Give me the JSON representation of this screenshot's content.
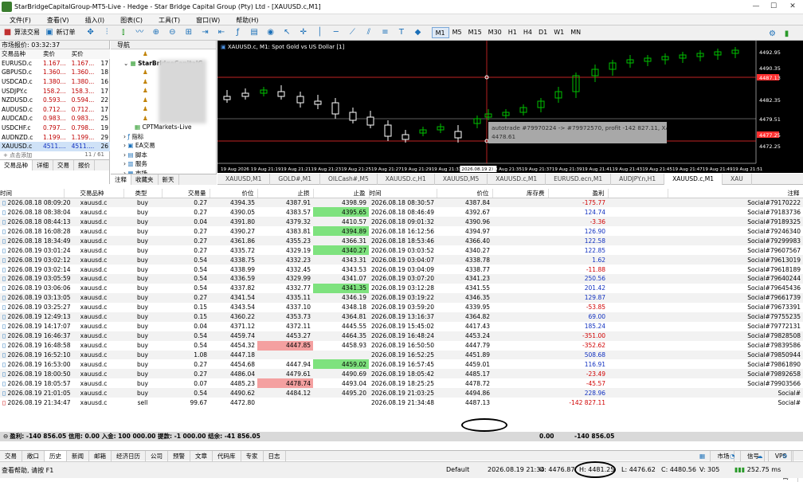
{
  "window": {
    "title": "StarBridgeCapitalGroup-MT5-Live - Hedge - Star Bridge Capital Group (Pty) Ltd - [XAUUSD.c,M1]",
    "controls": [
      "—",
      "☐",
      "✕"
    ]
  },
  "menu": [
    "文件(F)",
    "查看(V)",
    "插入(I)",
    "图表(C)",
    "工具(T)",
    "窗口(W)",
    "帮助(H)"
  ],
  "toolbar": {
    "algo_label": "算法交易",
    "new_order_label": "新订单",
    "timeframes": [
      "M1",
      "M5",
      "M15",
      "M30",
      "H1",
      "H4",
      "D1",
      "W1",
      "MN"
    ],
    "active_tf": "M1"
  },
  "market_watch": {
    "title": "市场报价: 03:32:37",
    "headers": [
      "交易品种",
      "卖价",
      "买价",
      ""
    ],
    "rows": [
      [
        "EURUSD.c",
        "1.167...",
        "1.167...",
        "17"
      ],
      [
        "GBPUSD.c",
        "1.360...",
        "1.360...",
        "18"
      ],
      [
        "USDCAD.c",
        "1.380...",
        "1.380...",
        "16"
      ],
      [
        "USDJPY.c",
        "158.2...",
        "158.3...",
        "17"
      ],
      [
        "NZDUSD.c",
        "0.593...",
        "0.594...",
        "22"
      ],
      [
        "AUDUSD.c",
        "0.712...",
        "0.712...",
        "17"
      ],
      [
        "AUDCAD.c",
        "0.983...",
        "0.983...",
        "25"
      ],
      [
        "USDCHF.c",
        "0.797...",
        "0.798...",
        "19"
      ],
      [
        "AUDNZD.c",
        "1.199...",
        "1.199...",
        "29"
      ],
      [
        "XAUUSD.c",
        "4511....",
        "4511....",
        "26"
      ]
    ],
    "footer_left": "+ 点击添加",
    "footer_right": "11 / 61",
    "tabs": [
      "交易品种",
      "详细",
      "交易",
      "报价"
    ]
  },
  "navigator": {
    "title": "导航",
    "broker": "StarBridgeCapitalG",
    "items": [
      "CPTMarkets-Live",
      "指标",
      "EA交易",
      "脚本",
      "服务",
      "市场"
    ],
    "tabs": [
      "注释",
      "收藏夹",
      "新天"
    ]
  },
  "chart": {
    "header": "XAUUSD.c, M1:  Spot Gold vs US Dollar [1]",
    "price_labels": [
      "4492.95",
      "4490.35",
      "4487.13",
      "4482.35",
      "4479.51",
      "4477.25",
      "4472.25"
    ],
    "time_labels": [
      "19 Aug 2026",
      "19 Aug 21:19",
      "19 Aug 21:21",
      "19 Aug 21:23",
      "19 Aug 21:25",
      "19 Aug 21:27",
      "19 Aug 21:29",
      "19 Aug 21:31",
      "2026.08.19 21:34",
      "19 Aug 21:35",
      "19 Aug 21:37",
      "19 Aug 21:39",
      "19 Aug 21:41",
      "19 Aug 21:43",
      "19 Aug 21:45",
      "19 Aug 21:47",
      "19 Aug 21:49",
      "19 Aug 21:51"
    ],
    "tooltip_line1": "autotrade #79970224 -> #79972570, profit -142 827.11, XAUUSD.c",
    "tooltip_line2": "4478.61",
    "colors": {
      "bull": "#00c000",
      "bear": "#ffffff",
      "level": "#ff3030",
      "bg": "#000000"
    }
  },
  "chart_tabs": [
    "XAUUSD,M1",
    "GOLD#,M1",
    "OILCash#,M5",
    "XAUUSD.c,H1",
    "XAUUSD,M5",
    "XAUUSD.c,M1",
    "EURUSD.ecn,M1",
    "AUDJPY.n,H1",
    "XAUUSD.c,M1",
    "XAU"
  ],
  "history": {
    "headers": [
      "时间",
      "交易品种",
      "类型",
      "交易量",
      "价位",
      "止损",
      "止盈",
      "时间",
      "价位",
      "库存费",
      "盈利",
      "",
      "注释"
    ],
    "rows": [
      [
        "2026.08.18 08:09:20",
        "xauusd.c",
        "buy",
        "0.27",
        "4394.35",
        "4387.91",
        "4398.99",
        "2026.08.18 08:30:57",
        "4387.84",
        "",
        "-175.77",
        "",
        "Social#79170222",
        "red",
        "",
        "lred"
      ],
      [
        "2026.08.18 08:38:04",
        "xauusd.c",
        "buy",
        "0.27",
        "4390.05",
        "4383.57",
        "4395.65",
        "2026.08.18 08:46:49",
        "4392.67",
        "",
        "124.74",
        "",
        "Social#79183736",
        "",
        "green",
        "blue"
      ],
      [
        "2026.08.18 08:44:13",
        "xauusd.c",
        "buy",
        "0.04",
        "4391.80",
        "4379.32",
        "4410.57",
        "2026.08.18 09:01:32",
        "4390.96",
        "",
        "-3.36",
        "",
        "Social#79189325",
        "",
        "",
        "lred"
      ],
      [
        "2026.08.18 16:08:28",
        "xauusd.c",
        "buy",
        "0.27",
        "4390.27",
        "4383.81",
        "4394.89",
        "2026.08.18 16:12:56",
        "4394.97",
        "",
        "126.90",
        "",
        "Social#79246340",
        "",
        "green",
        "blue"
      ],
      [
        "2026.08.18 18:34:49",
        "xauusd.c",
        "buy",
        "0.27",
        "4361.86",
        "4355.23",
        "4366.31",
        "2026.08.18 18:53:46",
        "4366.40",
        "",
        "122.58",
        "",
        "Social#79299983",
        "",
        "green",
        "blue"
      ],
      [
        "2026.08.19 03:01:24",
        "xauusd.c",
        "buy",
        "0.27",
        "4335.72",
        "4329.19",
        "4340.27",
        "2026.08.19 03:03:52",
        "4340.27",
        "",
        "122.85",
        "",
        "Social#79607567",
        "",
        "green",
        "blue"
      ],
      [
        "2026.08.19 03:02:12",
        "xauusd.c",
        "buy",
        "0.54",
        "4338.75",
        "4332.23",
        "4343.31",
        "2026.08.19 03:04:07",
        "4338.78",
        "",
        "1.62",
        "",
        "Social#79613019",
        "",
        "",
        "blue"
      ],
      [
        "2026.08.19 03:02:14",
        "xauusd.c",
        "buy",
        "0.54",
        "4338.99",
        "4332.45",
        "4343.53",
        "2026.08.19 03:04:09",
        "4338.77",
        "",
        "-11.88",
        "",
        "Social#79618189",
        "",
        "",
        "lred"
      ],
      [
        "2026.08.19 03:05:59",
        "xauusd.c",
        "buy",
        "0.54",
        "4336.59",
        "4329.99",
        "4341.07",
        "2026.08.19 03:07:20",
        "4341.23",
        "",
        "250.56",
        "",
        "Social#79640244",
        "",
        "green",
        "blue"
      ],
      [
        "2026.08.19 03:06:06",
        "xauusd.c",
        "buy",
        "0.54",
        "4337.82",
        "4332.77",
        "4341.35",
        "2026.08.19 03:12:28",
        "4341.55",
        "",
        "201.42",
        "",
        "Social#79645436",
        "",
        "green",
        "blue"
      ],
      [
        "2026.08.19 03:13:05",
        "xauusd.c",
        "buy",
        "0.27",
        "4341.54",
        "4335.11",
        "4346.19",
        "2026.08.19 03:19:22",
        "4346.35",
        "",
        "129.87",
        "",
        "Social#79661739",
        "",
        "green",
        "blue"
      ],
      [
        "2026.08.19 03:25:27",
        "xauusd.c",
        "buy",
        "0.15",
        "4343.54",
        "4337.10",
        "4348.18",
        "2026.08.19 03:59:20",
        "4339.95",
        "",
        "-53.85",
        "",
        "Social#79673391",
        "",
        "",
        "lred"
      ],
      [
        "2026.08.19 12:49:13",
        "xauusd.c",
        "buy",
        "0.15",
        "4360.22",
        "4353.73",
        "4364.81",
        "2026.08.19 13:16:37",
        "4364.82",
        "",
        "69.00",
        "",
        "Social#79755235",
        "",
        "green",
        "blue"
      ],
      [
        "2026.08.19 14:17:07",
        "xauusd.c",
        "buy",
        "0.04",
        "4371.12",
        "4372.11",
        "4445.55",
        "2026.08.19 15:45:02",
        "4417.43",
        "",
        "185.24",
        "",
        "Social#79772131",
        "",
        "",
        "blue"
      ],
      [
        "2026.08.19 16:46:37",
        "xauusd.c",
        "buy",
        "0.54",
        "4459.74",
        "4453.27",
        "4464.35",
        "2026.08.19 16:48:24",
        "4453.24",
        "",
        "-351.00",
        "",
        "Social#79828508",
        "red",
        "",
        "lred"
      ],
      [
        "2026.08.19 16:48:58",
        "xauusd.c",
        "buy",
        "0.54",
        "4454.32",
        "4447.85",
        "4458.93",
        "2026.08.19 16:50:50",
        "4447.79",
        "",
        "-352.62",
        "",
        "Social#79839586",
        "red",
        "",
        "lred"
      ],
      [
        "2026.08.19 16:52:10",
        "xauusd.c",
        "buy",
        "1.08",
        "4447.18",
        "",
        "",
        "2026.08.19 16:52:25",
        "4451.89",
        "",
        "508.68",
        "",
        "Social#79850944",
        "",
        "",
        "blue"
      ],
      [
        "2026.08.19 16:53:00",
        "xauusd.c",
        "buy",
        "0.27",
        "4454.68",
        "4447.94",
        "4459.02",
        "2026.08.19 16:57:45",
        "4459.01",
        "",
        "116.91",
        "",
        "Social#79861890",
        "",
        "green",
        "blue"
      ],
      [
        "2026.08.19 18:00:50",
        "xauusd.c",
        "buy",
        "0.27",
        "4486.04",
        "4479.61",
        "4490.69",
        "2026.08.19 18:05:42",
        "4485.17",
        "",
        "-23.49",
        "",
        "Social#79892658",
        "",
        "",
        "lred"
      ],
      [
        "2026.08.19 18:05:57",
        "xauusd.c",
        "buy",
        "0.07",
        "4485.23",
        "4478.74",
        "4493.04",
        "2026.08.19 18:25:25",
        "4478.72",
        "",
        "-45.57",
        "",
        "Social#79903566",
        "red",
        "",
        "lred"
      ],
      [
        "2026.08.19 21:01:05",
        "xauusd.c",
        "buy",
        "0.54",
        "4490.62",
        "4484.12",
        "4495.20",
        "2026.08.19 21:03:25",
        "4494.86",
        "",
        "228.96",
        "",
        "Social#",
        "",
        "",
        "blue"
      ],
      [
        "2026.08.19 21:34:47",
        "xauusd.c",
        "sell",
        "99.67",
        "4472.80",
        "",
        "",
        "2026.08.19 21:34:48",
        "4487.13",
        "",
        "-142 827.11",
        "",
        "Social#",
        "",
        "",
        "lred"
      ]
    ],
    "summary_label": "盈利: -140 856.05  信用: 0.00  入金: 100 000.00  提款: -1 000.00  结余: -41 856.05",
    "summary_swap": "0.00",
    "summary_profit": "-140 856.05"
  },
  "bottom_tabs": [
    "交易",
    "敞口",
    "历史",
    "新闻",
    "邮箱",
    "经济日历",
    "公司",
    "预警",
    "文章",
    "代码库",
    "专家",
    "日志"
  ],
  "bottom_right": [
    "市场",
    "信号",
    "VPS",
    "测试"
  ],
  "status": {
    "help": "查看帮助, 请按 F1",
    "profile": "Default",
    "datetime": "2026.08.19 21:34",
    "open": "O: 4476.87",
    "high": "H: 4481.25",
    "low": "L: 4476.62",
    "close": "C: 4480.56",
    "volume": "V: 305",
    "traffic": "252.75 ms"
  }
}
